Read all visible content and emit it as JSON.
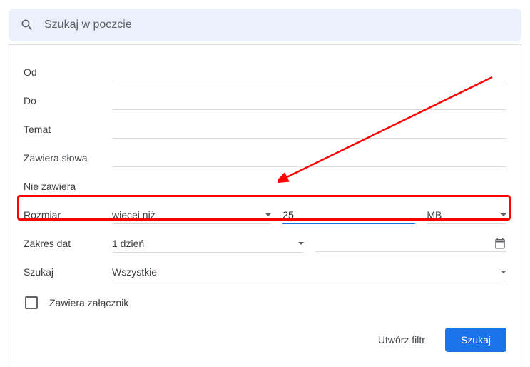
{
  "search": {
    "placeholder": "Szukaj w poczcie"
  },
  "form": {
    "from_label": "Od",
    "to_label": "Do",
    "subject_label": "Temat",
    "has_words_label": "Zawiera słowa",
    "not_has_label": "Nie zawiera",
    "size_label": "Rozmiar",
    "size_comparator": "więcej niż",
    "size_value": "25",
    "size_unit": "MB",
    "date_range_label": "Zakres dat",
    "date_range_value": "1 dzień",
    "search_scope_label": "Szukaj",
    "search_scope_value": "Wszystkie",
    "has_attachment_label": "Zawiera załącznik"
  },
  "buttons": {
    "create_filter": "Utwórz filtr",
    "search": "Szukaj"
  }
}
